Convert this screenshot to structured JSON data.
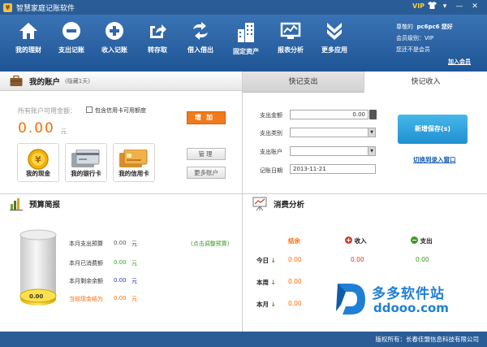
{
  "window": {
    "title": "智慧家庭记账软件",
    "vip_label": "VIP",
    "controls": [
      "▾",
      "—",
      "✕"
    ]
  },
  "toolbar": {
    "items": [
      {
        "label": "我的理财",
        "icon": "home-icon"
      },
      {
        "label": "支出记账",
        "icon": "minus-circle-icon"
      },
      {
        "label": "收入记账",
        "icon": "plus-circle-icon"
      },
      {
        "label": "转存取",
        "icon": "share-arrow-icon"
      },
      {
        "label": "借入借出",
        "icon": "swap-arrows-icon"
      },
      {
        "label": "固定资产",
        "icon": "building-icon"
      },
      {
        "label": "报表分析",
        "icon": "chart-monitor-icon"
      },
      {
        "label": "更多应用",
        "icon": "double-chevron-icon"
      }
    ]
  },
  "user": {
    "greeting_prefix": "尊敬的",
    "username": "pc6pc6",
    "greeting_suffix": "您好",
    "level_prefix": "会员级别：",
    "level_value": "VIP",
    "status_text": "您还不是会员",
    "join_link": "加入会员"
  },
  "account": {
    "title": "我的账户",
    "subtitle": "(隐藏1天)",
    "available_label": "所有账户可用金额：",
    "include_credit_label": "包含信用卡可用额度",
    "amount": "0.00",
    "unit": "元",
    "add_button": "增加",
    "manage_button": "管理",
    "more_button": "更多账户",
    "cards": [
      {
        "caption": "我的现金",
        "icon": "coin-icon"
      },
      {
        "caption": "我的银行卡",
        "icon": "bank-card-icon"
      },
      {
        "caption": "我的信用卡",
        "icon": "credit-card-icon"
      }
    ]
  },
  "quick_entry": {
    "tab_expense": "快记支出",
    "tab_income": "快记收入",
    "amount_label": "支出金额",
    "amount_value": "0.00",
    "category_label": "支出类别",
    "account_label": "支出账户",
    "date_label": "记账日期",
    "date_value": "2013-11-21",
    "save_button": "新增保存(s)",
    "switch_link": "切换到录入窗口"
  },
  "budget": {
    "title": "预算简报",
    "cylinder_value": "0.00",
    "adjust_link": "(点击调整预算)",
    "rows": [
      {
        "label": "本月支出预算",
        "value": "0.00",
        "unit": "元"
      },
      {
        "label": "本月已消费额",
        "value": "0.00",
        "unit": "元"
      },
      {
        "label": "本月剩余余额",
        "value": "0.00",
        "unit": "元"
      },
      {
        "label": "当前现金结为",
        "value": "0.00",
        "unit": "元"
      }
    ]
  },
  "consumption": {
    "title": "消费分析",
    "col_balance": "结余",
    "col_income": "收入",
    "col_expense": "支出",
    "rows": [
      {
        "label": "今日",
        "balance": "0.00",
        "income": "0.00",
        "expense": "0.00"
      },
      {
        "label": "本周",
        "balance": "0.00",
        "income": "",
        "expense": ""
      },
      {
        "label": "本月",
        "balance": "0.00",
        "income": "",
        "expense": ""
      }
    ]
  },
  "watermark": {
    "name": "多多软件站",
    "url": "ddooo.com"
  },
  "statusbar": {
    "copyright": "版权所有：长春佳盟信息科技有限公司"
  },
  "colors": {
    "titlebar": "#2a5d96",
    "toolbar": "#2f68aa",
    "accent_orange": "#f07a1c",
    "save_blue": "#2aa3de",
    "income_red": "#d43a2a",
    "expense_green": "#3d9a28"
  }
}
